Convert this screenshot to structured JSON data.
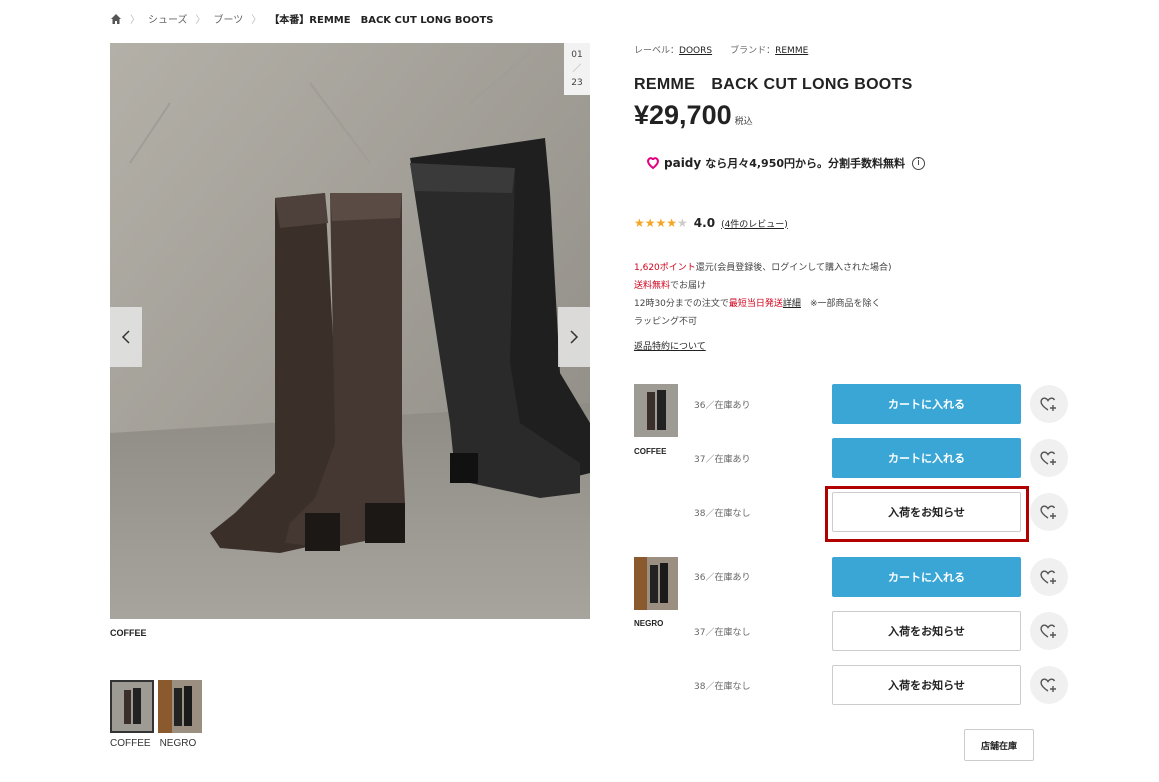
{
  "breadcrumb": {
    "home_icon": "home-icon",
    "items": [
      "シューズ",
      "ブーツ"
    ],
    "current": "【本番】REMME　BACK CUT LONG BOOTS"
  },
  "gallery": {
    "counter_current": "01",
    "counter_sep": "／",
    "counter_total": "23",
    "caption": "COFFEE",
    "thumb_labels": [
      "COFFEE",
      "NEGRO"
    ]
  },
  "product": {
    "label_prefix": "レーベル：",
    "label_value": "DOORS",
    "brand_prefix": "ブランド：",
    "brand_value": "REMME",
    "title": "REMME　BACK CUT LONG BOOTS",
    "price": "¥29,700",
    "tax": "税込",
    "paidy_brand": "paidy",
    "paidy_text": "なら月々4,950円から。分割手数料無料",
    "paidy_info": "i",
    "rating_value": "4.0",
    "rating_link": "(4件のレビュー)",
    "rating_stars": 4,
    "points_red": "1,620ポイント",
    "points_rest": "還元(会員登録後、ログインして購入された場合)",
    "shipping_red": "送料無料",
    "shipping_rest": "でお届け",
    "sameday_pre": "12時30分までの注文で",
    "sameday_red": "最短当日発送",
    "sameday_link": "詳細",
    "sameday_note": "　※一部商品を除く",
    "wrapping": "ラッピング不可",
    "returns": "返品特約について"
  },
  "variants": {
    "colors": [
      {
        "name": "COFFEE",
        "sizes": [
          {
            "label": "36／在庫あり",
            "button": "カートに入れる",
            "type": "cart"
          },
          {
            "label": "37／在庫あり",
            "button": "カートに入れる",
            "type": "cart"
          },
          {
            "label": "38／在庫なし",
            "button": "入荷をお知らせ",
            "type": "notify"
          }
        ]
      },
      {
        "name": "NEGRO",
        "sizes": [
          {
            "label": "36／在庫あり",
            "button": "カートに入れる",
            "type": "cart"
          },
          {
            "label": "37／在庫なし",
            "button": "入荷をお知らせ",
            "type": "notify"
          },
          {
            "label": "38／在庫なし",
            "button": "入荷をお知らせ",
            "type": "notify"
          }
        ]
      }
    ],
    "store_stock": "店舗在庫"
  },
  "colors": {
    "cart": "#3aa6d5",
    "highlight": "#b00000",
    "star": "#f5a623",
    "red_text": "#d0021b"
  }
}
